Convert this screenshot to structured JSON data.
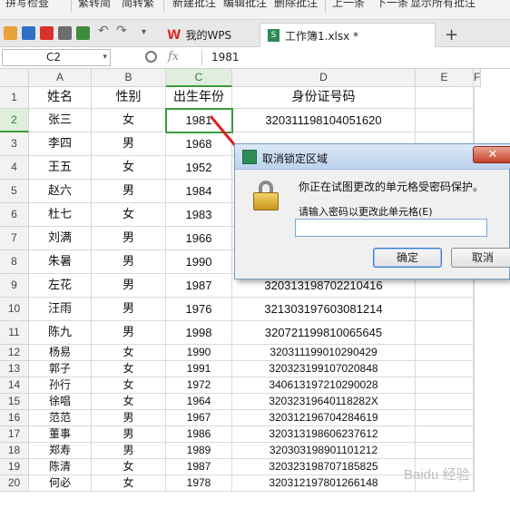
{
  "ribbon": {
    "items": [
      "拼写检查",
      "繁转简",
      "简转繁",
      "新建批注",
      "编辑批注",
      "删除批注",
      "上一条",
      "下一条",
      "显示所有批注"
    ]
  },
  "tabs": {
    "home": "我的WPS",
    "workbook": "工作簿1.xlsx *",
    "new_tab": "+"
  },
  "formula_bar": {
    "cell_ref": "C2",
    "fx": "fx",
    "value": "1981"
  },
  "sheet": {
    "columns": [
      "A",
      "B",
      "C",
      "D",
      "E",
      "F"
    ],
    "rows": [
      {
        "n": "1",
        "a": "姓名",
        "b": "性别",
        "c": "出生年份",
        "d": "身份证号码"
      },
      {
        "n": "2",
        "a": "张三",
        "b": "女",
        "c": "1981",
        "d": "320311198104051620"
      },
      {
        "n": "3",
        "a": "李四",
        "b": "男",
        "c": "1968",
        "d": ""
      },
      {
        "n": "4",
        "a": "王五",
        "b": "女",
        "c": "1952",
        "d": ""
      },
      {
        "n": "5",
        "a": "赵六",
        "b": "男",
        "c": "1984",
        "d": ""
      },
      {
        "n": "6",
        "a": "杜七",
        "b": "女",
        "c": "1983",
        "d": ""
      },
      {
        "n": "7",
        "a": "刘满",
        "b": "男",
        "c": "1966",
        "d": ""
      },
      {
        "n": "8",
        "a": "朱暑",
        "b": "男",
        "c": "1990",
        "d": ""
      },
      {
        "n": "9",
        "a": "左花",
        "b": "男",
        "c": "1987",
        "d": "320313198702210416"
      },
      {
        "n": "10",
        "a": "汪雨",
        "b": "男",
        "c": "1976",
        "d": "321303197603081214"
      },
      {
        "n": "11",
        "a": "陈九",
        "b": "男",
        "c": "1998",
        "d": "320721199810065645"
      },
      {
        "n": "12",
        "a": "杨易",
        "b": "女",
        "c": "1990",
        "d": "320311199010290429"
      },
      {
        "n": "13",
        "a": "郭子",
        "b": "女",
        "c": "1991",
        "d": "320323199107020848"
      },
      {
        "n": "14",
        "a": "孙行",
        "b": "女",
        "c": "1972",
        "d": "340613197210290028"
      },
      {
        "n": "15",
        "a": "徐唱",
        "b": "女",
        "c": "1964",
        "d": "32032319640118282X"
      },
      {
        "n": "16",
        "a": "范范",
        "b": "男",
        "c": "1967",
        "d": "320312196704284619"
      },
      {
        "n": "17",
        "a": "董事",
        "b": "男",
        "c": "1986",
        "d": "320313198606237612"
      },
      {
        "n": "18",
        "a": "郑寿",
        "b": "男",
        "c": "1989",
        "d": "320303198901101212"
      },
      {
        "n": "19",
        "a": "陈清",
        "b": "女",
        "c": "1987",
        "d": "320323198707185825"
      },
      {
        "n": "20",
        "a": "何必",
        "b": "女",
        "c": "1978",
        "d": "320312197801266148"
      }
    ]
  },
  "dialog": {
    "title": "取消锁定区域",
    "message": "你正在试图更改的单元格受密码保护。",
    "prompt": "请输入密码以更改此单元格(E)",
    "password_value": "",
    "ok_label": "确定",
    "cancel_label": "取消",
    "close_glyph": "✕"
  },
  "watermark": "Baidu 经验",
  "colors": {
    "selection": "#3a9a3a",
    "wps_red": "#d9322b",
    "arrow": "#e02020"
  }
}
